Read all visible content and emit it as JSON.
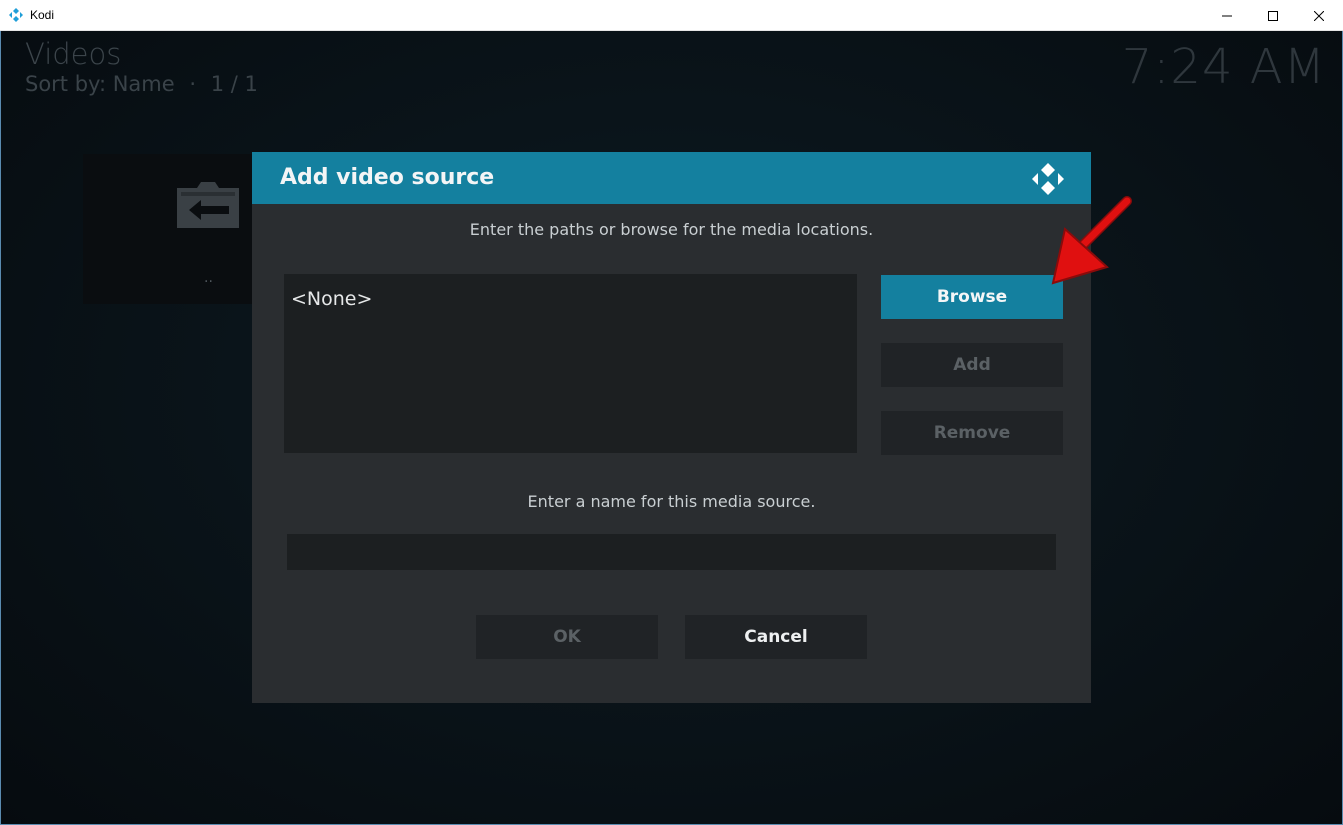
{
  "window": {
    "title": "Kodi",
    "controls": {
      "minimize": "minimize-icon",
      "maximize": "maximize-icon",
      "close": "close-icon"
    }
  },
  "header": {
    "title": "Videos",
    "sort_label": "Sort by: Name",
    "separator": "·",
    "page": "1 / 1",
    "clock": "7:24 AM"
  },
  "background": {
    "back_item_label": ".."
  },
  "dialog": {
    "title": "Add video source",
    "paths_hint": "Enter the paths or browse for the media locations.",
    "paths": [
      "<None>"
    ],
    "buttons": {
      "browse": "Browse",
      "add": "Add",
      "remove": "Remove"
    },
    "name_hint": "Enter a name for this media source.",
    "name_value": "",
    "ok": "OK",
    "cancel": "Cancel"
  },
  "colors": {
    "accent": "#14809f",
    "dialog_bg": "#2a2d30",
    "annotation_arrow": "#e01010"
  }
}
